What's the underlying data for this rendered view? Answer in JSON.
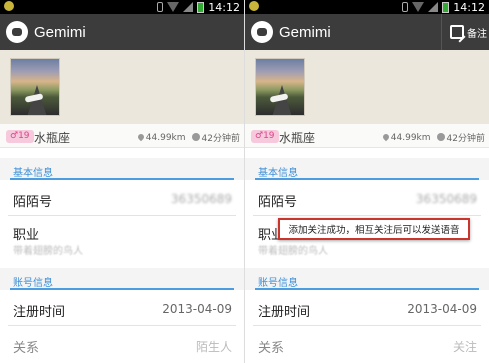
{
  "statusbar": {
    "time": "14:12"
  },
  "app": {
    "title": "Gemimi",
    "note_label": "备注"
  },
  "profile": {
    "age": "♂19",
    "zodiac": "水瓶座",
    "distance": "44.99km",
    "last_seen": "42分钟前"
  },
  "sections": {
    "basic": "基本信息",
    "account": "账号信息"
  },
  "rows": {
    "momo_label": "陌陌号",
    "momo_value": "36350689",
    "job_label": "职业",
    "job_sub": "带着翅膀的鸟人",
    "register_label": "注册时间",
    "register_value": "2013-04-09",
    "relation_label": "关系",
    "relation_left": "陌生人",
    "relation_right": "关注"
  },
  "toast": {
    "text": "添加关注成功，相互关注后可以发送语音"
  }
}
